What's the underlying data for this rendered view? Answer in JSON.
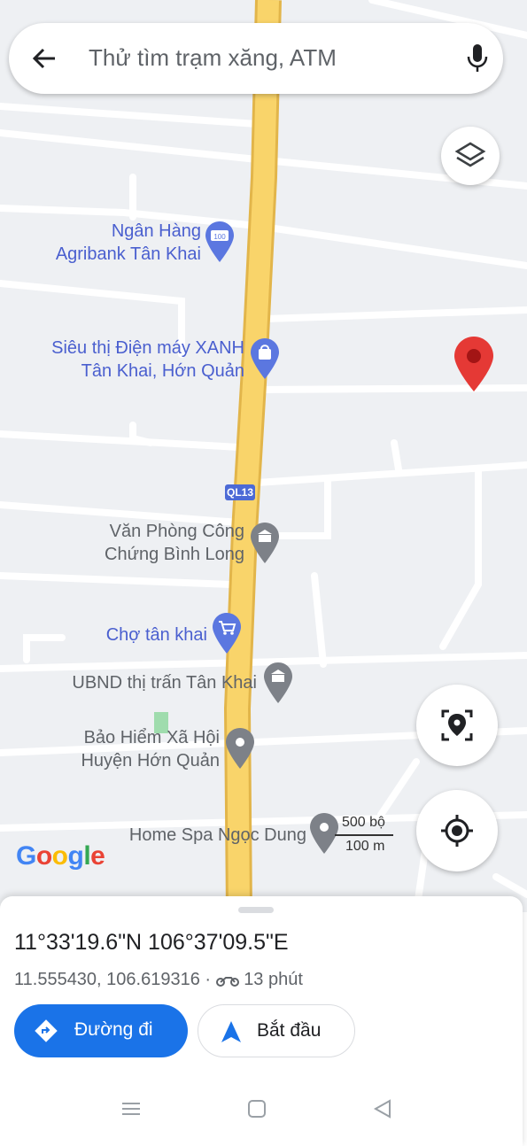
{
  "search": {
    "placeholder": "Thử tìm trạm xăng, ATM"
  },
  "map": {
    "route_label": "QL13",
    "pois": {
      "agribank": [
        "Ngân Hàng",
        "Agribank Tân Khai"
      ],
      "dienmayxanh": [
        "Siêu thị Điện máy XANH",
        "Tân Khai, Hớn Quản"
      ],
      "congchung": [
        "Văn Phòng Công",
        "Chứng Bình Long"
      ],
      "cho": "Chợ tân khai",
      "ubnd": "UBND thị trấn Tân Khai",
      "baohiem": [
        "Bảo Hiểm Xã Hội",
        "Huyện Hớn Quản"
      ],
      "spa": "Home Spa Ngọc Dung"
    },
    "scale": {
      "top": "500 bộ",
      "bottom": "100 m"
    },
    "logo": [
      "G",
      "o",
      "o",
      "g",
      "l",
      "e"
    ],
    "icons": [
      "layers-icon",
      "street-view-icon",
      "my-location-icon"
    ]
  },
  "sheet": {
    "coords": "11°33'19.6\"N 106°37'09.5\"E",
    "decimal": "11.555430, 106.619316 ·",
    "travel_time": "13 phút",
    "directions_label": "Đường đi",
    "start_label": "Bắt đầu"
  },
  "colors": {
    "accent": "#1a73e8",
    "road": "#f9d46a",
    "pin": "#e53935",
    "poi_text": "#4a5fcf"
  }
}
